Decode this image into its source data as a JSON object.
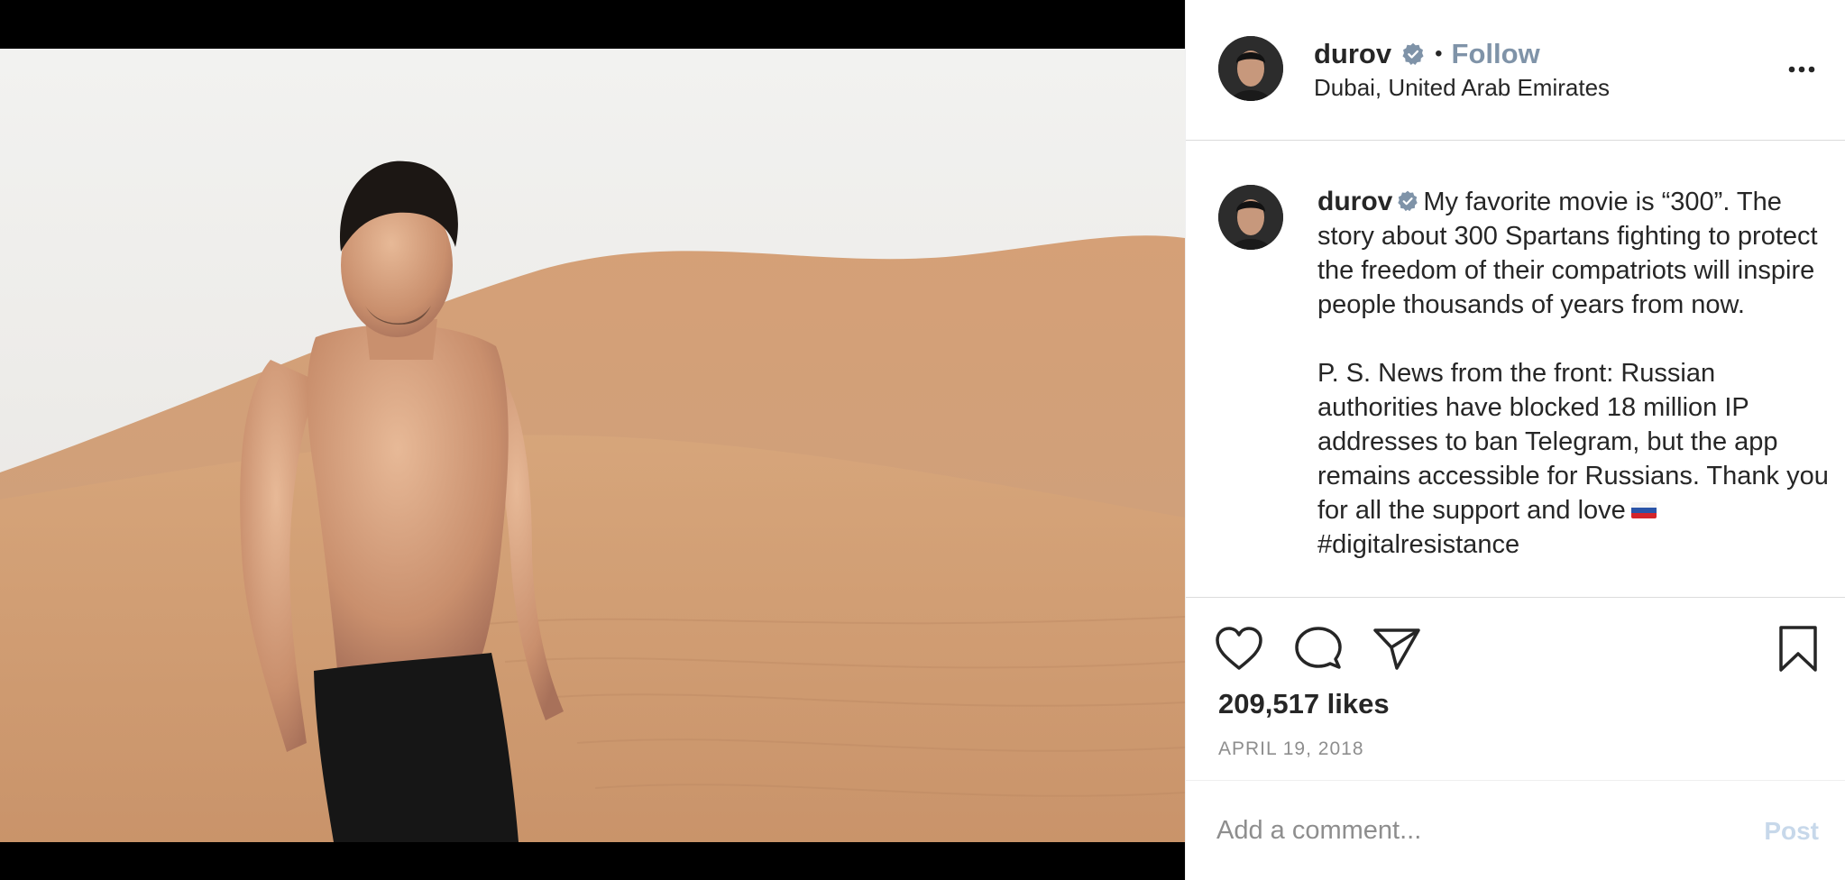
{
  "post": {
    "author": {
      "username": "durov",
      "verified": true,
      "follow_label": "Follow",
      "location": "Dubai, United Arab Emirates",
      "avatar_icon": "avatar-photo"
    },
    "caption": {
      "username": "durov",
      "text_paragraph_1": "My favorite movie is “300”. The story about 300 Spartans fighting to protect the freedom of their compatriots will inspire people thousands of years from now.",
      "text_paragraph_2": "P. S. News from the front: Russian authorities have blocked 18 million IP addresses to ban Telegram, but the app remains accessible for Russians. Thank you for all the support and love",
      "hashtag": "#digitalresistance"
    },
    "actions": {
      "like_icon": "heart-icon",
      "comment_icon": "comment-icon",
      "share_icon": "share-icon",
      "save_icon": "bookmark-icon"
    },
    "likes": "209,517 likes",
    "date": "APRIL 19, 2018",
    "comment": {
      "placeholder": "Add a comment...",
      "post_label": "Post"
    }
  },
  "colors": {
    "follow": "#7f93a8",
    "verified": "#7f93a8",
    "post_disabled": "#c7d8ea",
    "muted_text": "#8e8e8e",
    "divider": "#dbdbdb"
  }
}
